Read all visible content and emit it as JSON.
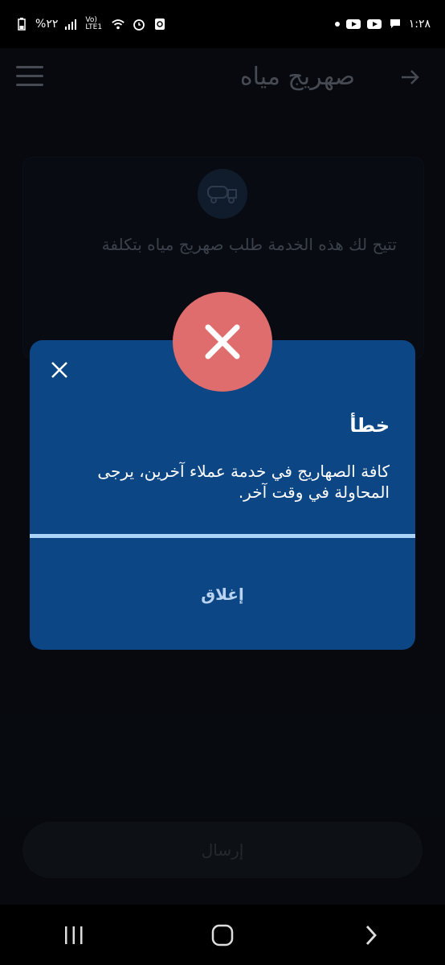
{
  "status_bar": {
    "battery_text": "%٢٢",
    "network_label": "Vo) LTE1",
    "time": "١:٢٨"
  },
  "app": {
    "title": "صهريج مياه",
    "description": "تتيح لك هذه الخدمة طلب صهريج مياه بتكلفة",
    "send_label": "إرسال"
  },
  "dialog": {
    "title": "خطأ",
    "message": "كافة الصهاريج في خدمة عملاء آخرين، يرجى المحاولة في وقت آخر.",
    "close_label": "إغلاق"
  },
  "colors": {
    "dialog_bg": "#0d4685",
    "error_badge": "#e06d6d",
    "divider": "#a9d4f7"
  }
}
